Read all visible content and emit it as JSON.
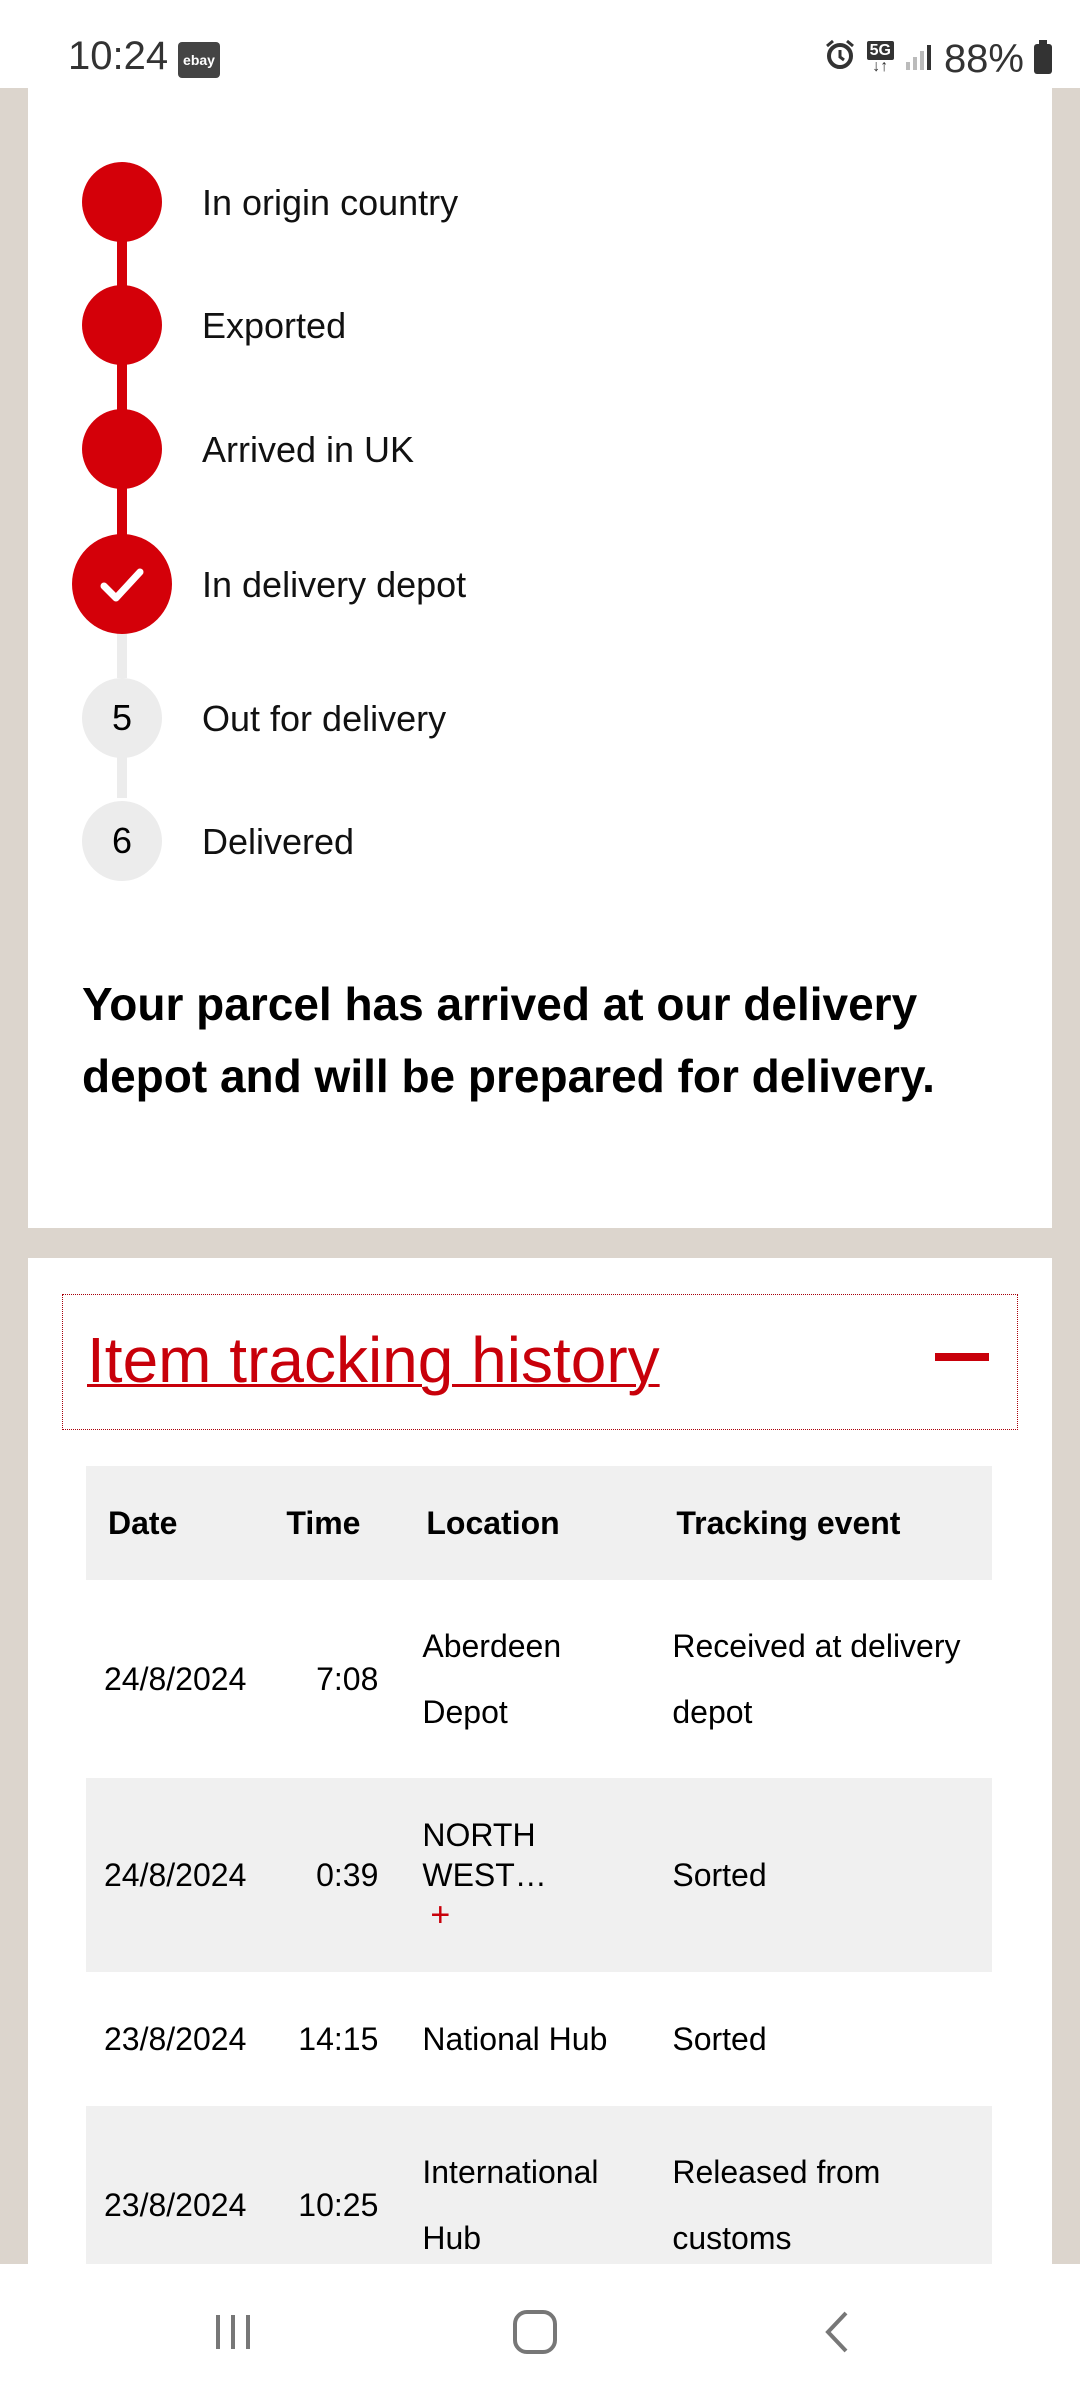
{
  "status_bar": {
    "time": "10:24",
    "app_icon_label": "ebay",
    "network": "5G",
    "battery": "88%"
  },
  "progress": {
    "steps": [
      {
        "label": "In origin country",
        "state": "done"
      },
      {
        "label": "Exported",
        "state": "done"
      },
      {
        "label": "Arrived in UK",
        "state": "done"
      },
      {
        "label": "In delivery depot",
        "state": "current"
      },
      {
        "label": "Out for delivery",
        "state": "pending",
        "number": "5"
      },
      {
        "label": "Delivered",
        "state": "pending",
        "number": "6"
      }
    ],
    "summary": "Your parcel has arrived at our delivery depot and will be prepared for delivery."
  },
  "history": {
    "title": "Item tracking history",
    "columns": [
      "Date",
      "Time",
      "Location",
      "Tracking event"
    ],
    "rows": [
      {
        "date": "24/8/2024",
        "time": "7:08",
        "location": "Aberdeen Depot",
        "event": "Received at delivery depot"
      },
      {
        "date": "24/8/2024",
        "time": "0:39",
        "location": "NORTH WEST…",
        "location_extra": "+",
        "event": "Sorted"
      },
      {
        "date": "23/8/2024",
        "time": "14:15",
        "location": "National Hub",
        "event": "Sorted"
      },
      {
        "date": "23/8/2024",
        "time": "10:25",
        "location": "International Hub",
        "event": "Released from customs"
      }
    ]
  },
  "colors": {
    "accent": "#d40009",
    "pending": "#ececec",
    "page_bg": "#dcd5cd"
  }
}
